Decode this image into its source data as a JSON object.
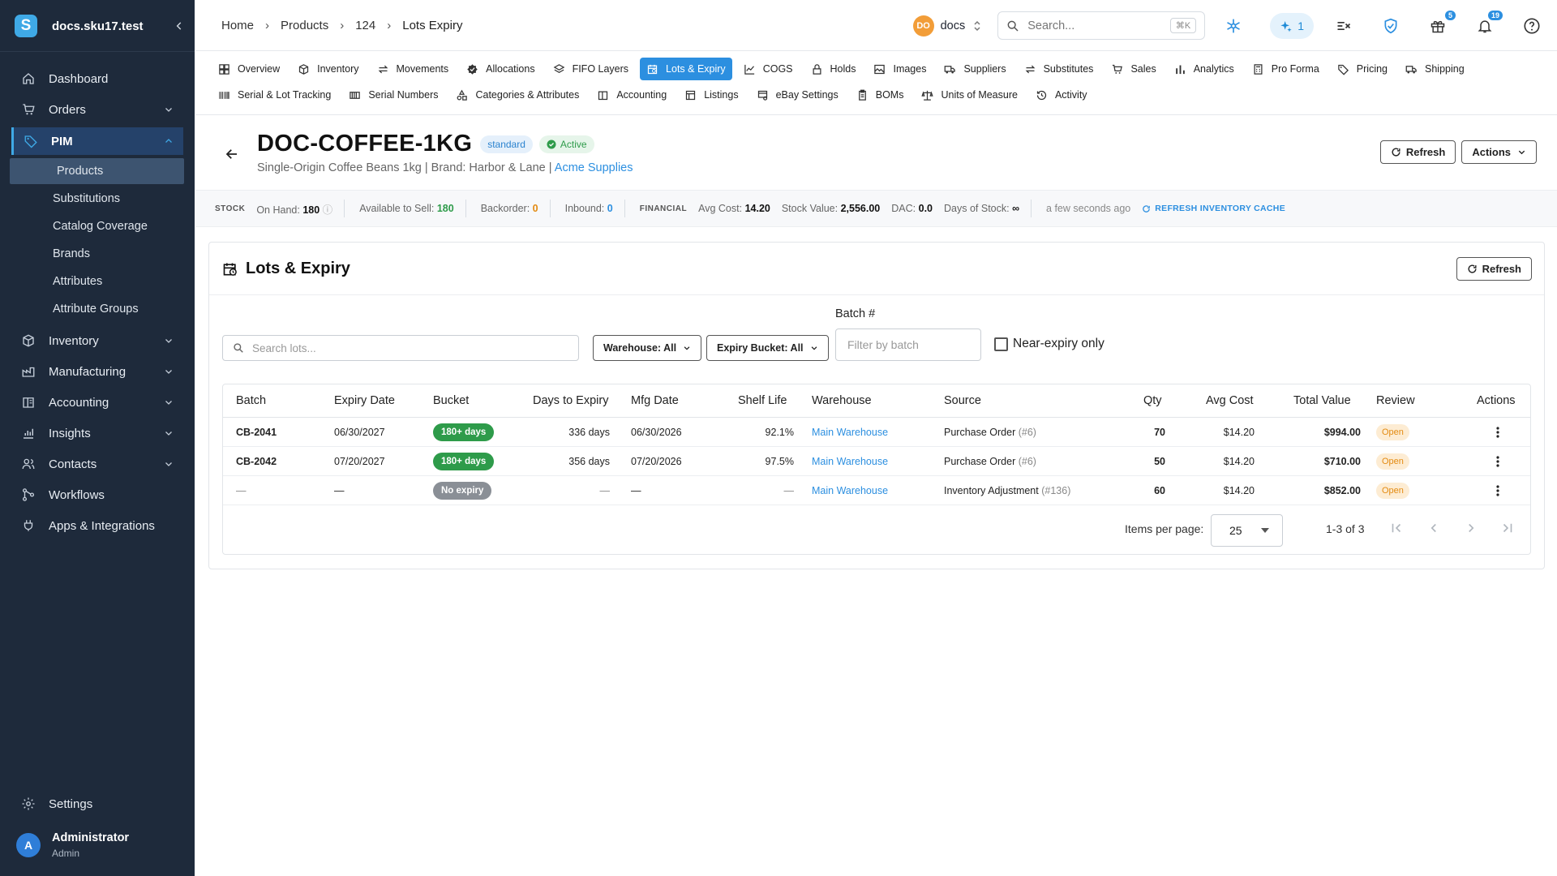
{
  "sidebar": {
    "title": "docs.sku17.test",
    "logo_letter": "S",
    "nav": [
      {
        "label": "Dashboard",
        "icon": "home-icon"
      },
      {
        "label": "Orders",
        "icon": "cart-icon"
      },
      {
        "label": "PIM",
        "icon": "tag-icon"
      },
      {
        "label": "Inventory",
        "icon": "box-icon"
      },
      {
        "label": "Manufacturing",
        "icon": "factory-icon"
      },
      {
        "label": "Accounting",
        "icon": "ledger-icon"
      },
      {
        "label": "Insights",
        "icon": "chart-icon"
      },
      {
        "label": "Contacts",
        "icon": "people-icon"
      },
      {
        "label": "Workflows",
        "icon": "workflow-icon"
      },
      {
        "label": "Apps & Integrations",
        "icon": "plug-icon"
      }
    ],
    "pim_sub": [
      "Products",
      "Substitutions",
      "Catalog Coverage",
      "Brands",
      "Attributes",
      "Attribute Groups"
    ],
    "settings": "Settings",
    "user": {
      "initial": "A",
      "name": "Administrator",
      "role": "Admin"
    }
  },
  "topbar": {
    "crumbs": [
      "Home",
      "Products",
      "124",
      "Lots Expiry"
    ],
    "workspace_badge": "DO",
    "workspace": "docs",
    "search_placeholder": "Search...",
    "search_kbd": "⌘K",
    "ai_count": "1",
    "gift_badge": "5",
    "bell_badge": "19"
  },
  "tabs": {
    "row1": [
      "Overview",
      "Inventory",
      "Movements",
      "Allocations",
      "FIFO Layers",
      "Lots & Expiry",
      "COGS",
      "Holds",
      "Images",
      "Suppliers",
      "Substitutes",
      "Sales",
      "Analytics",
      "Pro Forma",
      "Pricing",
      "Shipping"
    ],
    "row2": [
      "Serial & Lot Tracking",
      "Serial Numbers",
      "Categories & Attributes",
      "Accounting",
      "Listings",
      "eBay Settings",
      "BOMs",
      "Units of Measure",
      "Activity"
    ],
    "active": "Lots & Expiry"
  },
  "product": {
    "sku": "DOC-COFFEE-1KG",
    "type_pill": "standard",
    "status_pill": "Active",
    "name": "Single-Origin Coffee Beans 1kg",
    "brand": "| Brand: Harbor & Lane |",
    "supplier": "Acme Supplies",
    "refresh": "Refresh",
    "actions": "Actions"
  },
  "stock": {
    "stock_label": "STOCK",
    "on_hand_label": "On Hand:",
    "on_hand": "180",
    "ats_label": "Available to Sell:",
    "ats": "180",
    "backorder_label": "Backorder:",
    "backorder": "0",
    "inbound_label": "Inbound:",
    "inbound": "0",
    "financial_label": "FINANCIAL",
    "avg_cost_label": "Avg Cost:",
    "avg_cost": "14.20",
    "stock_value_label": "Stock Value:",
    "stock_value": "2,556.00",
    "dac_label": "DAC:",
    "dac": "0.0",
    "dos_label": "Days of Stock:",
    "dos": "∞",
    "updated": "a few seconds ago",
    "refresh_cache": "REFRESH INVENTORY CACHE"
  },
  "card": {
    "title": "Lots & Expiry",
    "refresh": "Refresh",
    "search_placeholder": "Search lots...",
    "warehouse_filter": "Warehouse: All",
    "bucket_filter": "Expiry Bucket: All",
    "batch_label": "Batch #",
    "batch_placeholder": "Filter by batch",
    "near_expiry": "Near-expiry only"
  },
  "table": {
    "headers": [
      "Batch",
      "Expiry Date",
      "Bucket",
      "Days to Expiry",
      "Mfg Date",
      "Shelf Life",
      "Warehouse",
      "Source",
      "Qty",
      "Avg Cost",
      "Total Value",
      "Review",
      "Actions"
    ],
    "rows": [
      {
        "batch": "CB-2041",
        "expiry": "06/30/2027",
        "bucket": "180+ days",
        "days": "336 days",
        "mfg": "06/30/2026",
        "shelf": "92.1%",
        "warehouse": "Main Warehouse",
        "source": "Purchase Order",
        "source_ref": "(#6)",
        "qty": "70",
        "avg": "$14.20",
        "total": "$994.00",
        "review": "Open"
      },
      {
        "batch": "CB-2042",
        "expiry": "07/20/2027",
        "bucket": "180+ days",
        "days": "356 days",
        "mfg": "07/20/2026",
        "shelf": "97.5%",
        "warehouse": "Main Warehouse",
        "source": "Purchase Order",
        "source_ref": "(#6)",
        "qty": "50",
        "avg": "$14.20",
        "total": "$710.00",
        "review": "Open"
      },
      {
        "batch": "—",
        "expiry": "—",
        "bucket": "No expiry",
        "days": "—",
        "mfg": "—",
        "shelf": "—",
        "warehouse": "Main Warehouse",
        "source": "Inventory Adjustment",
        "source_ref": "(#136)",
        "qty": "60",
        "avg": "$14.20",
        "total": "$852.00",
        "review": "Open"
      }
    ],
    "items_per_page_label": "Items per page:",
    "items_per_page": "25",
    "range": "1-3 of 3"
  },
  "colors": {
    "accent": "#2c8fe0",
    "sidebar_bg": "#1e2a3b",
    "bucket_green": "#2e9b4a",
    "bucket_gray": "#8a8f96",
    "review_bg": "#fdecd3"
  }
}
